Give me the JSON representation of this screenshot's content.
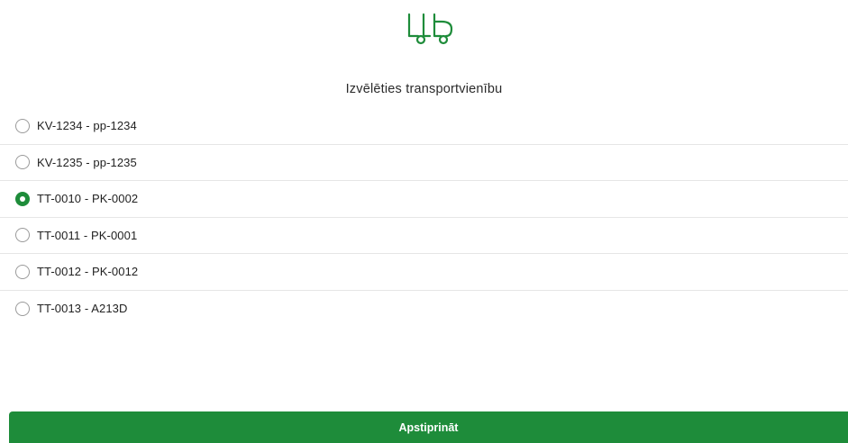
{
  "header": {
    "logo_icon": "truck-trailer-icon",
    "title": "Izvēlēties transportvienību"
  },
  "vehicles": [
    {
      "label": "KV-1234 - pp-1234",
      "selected": false
    },
    {
      "label": "KV-1235 - pp-1235",
      "selected": false
    },
    {
      "label": "TT-0010 - PK-0002",
      "selected": true
    },
    {
      "label": "TT-0011 - PK-0001",
      "selected": false
    },
    {
      "label": "TT-0012 - PK-0012",
      "selected": false
    },
    {
      "label": "TT-0013 - A213D",
      "selected": false
    }
  ],
  "footer": {
    "confirm_label": "Apstiprināt"
  },
  "colors": {
    "accent": "#1e8c3a",
    "divider": "#e6e6e6",
    "radio_border": "#9a9a9a"
  }
}
